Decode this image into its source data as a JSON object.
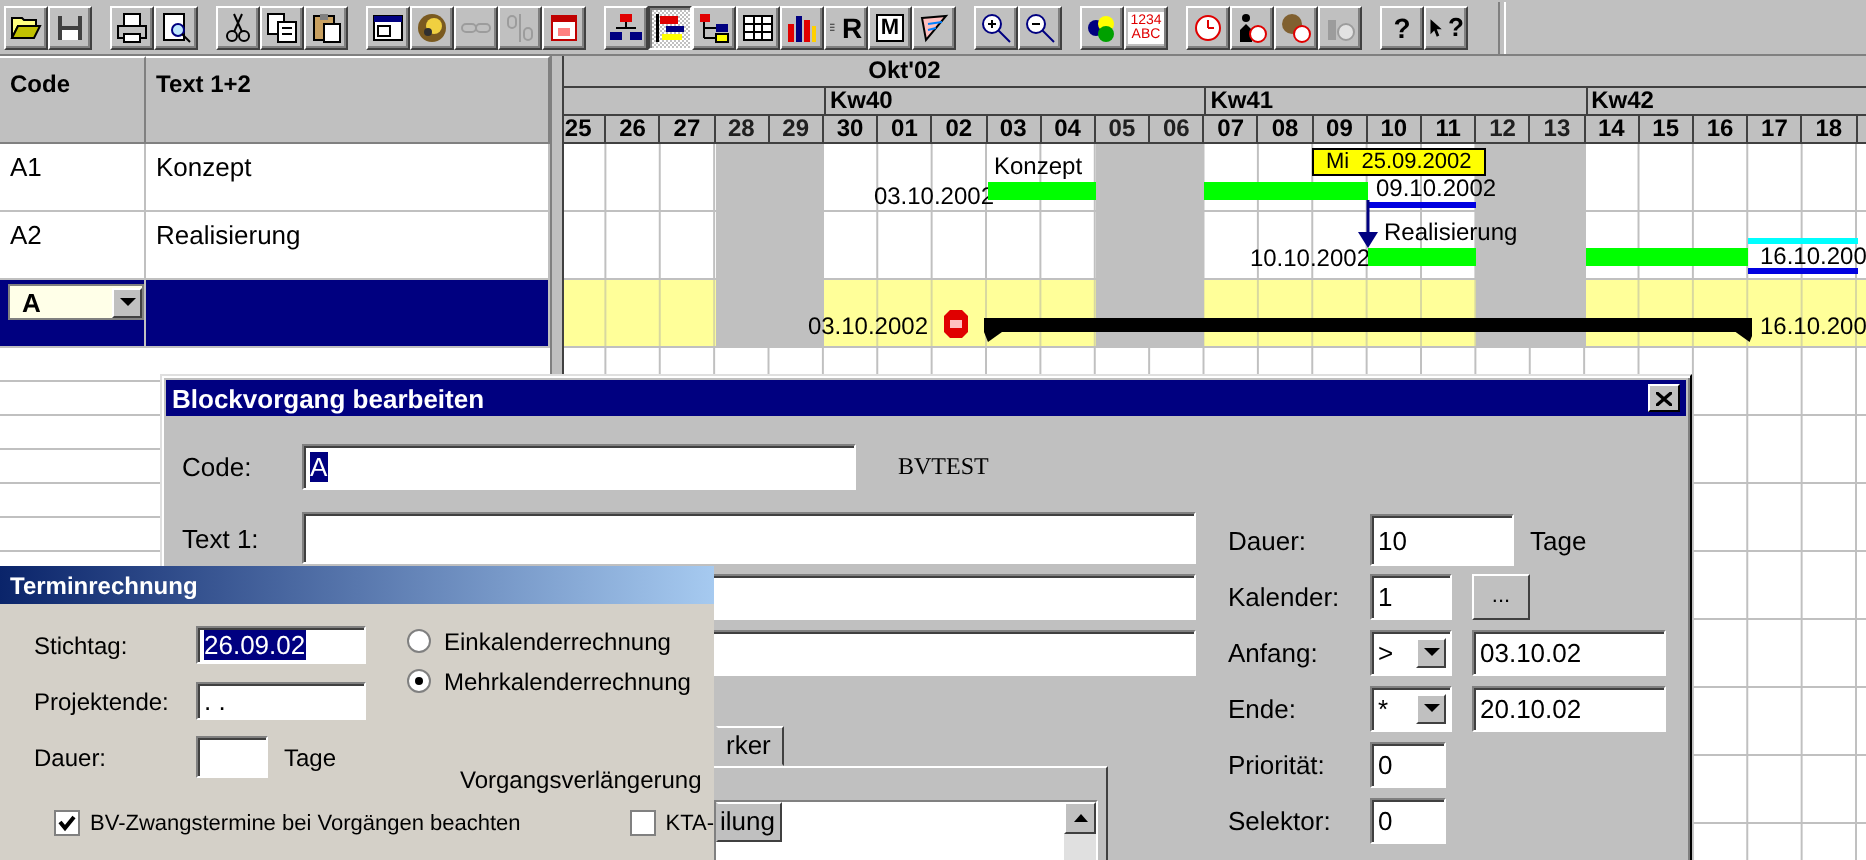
{
  "toolbar": [
    [
      {
        "kind": "folder",
        "pressed": false,
        "disabled": false
      },
      {
        "kind": "save",
        "pressed": false,
        "disabled": false
      }
    ],
    [
      {
        "kind": "printer",
        "pressed": false,
        "disabled": false
      },
      {
        "kind": "preview",
        "pressed": false,
        "disabled": false
      }
    ],
    [
      {
        "kind": "scissors",
        "pressed": false,
        "disabled": false
      },
      {
        "kind": "copy",
        "pressed": false,
        "disabled": false
      },
      {
        "kind": "paste",
        "pressed": false,
        "disabled": false
      }
    ],
    [
      {
        "kind": "window",
        "pressed": false,
        "disabled": false
      },
      {
        "kind": "globe",
        "pressed": false,
        "disabled": false
      },
      {
        "kind": "chain",
        "pressed": false,
        "disabled": true
      },
      {
        "kind": "unchain",
        "pressed": false,
        "disabled": true
      },
      {
        "kind": "calendar",
        "pressed": false,
        "disabled": false
      }
    ],
    [
      {
        "kind": "orgchart",
        "pressed": false,
        "disabled": false
      },
      {
        "kind": "gantt",
        "pressed": true,
        "disabled": false
      },
      {
        "kind": "tree",
        "pressed": false,
        "disabled": false
      },
      {
        "kind": "table",
        "pressed": false,
        "disabled": false
      },
      {
        "kind": "barchart",
        "pressed": false,
        "disabled": false
      },
      {
        "kind": "report",
        "label": "R",
        "pressed": false,
        "disabled": false
      },
      {
        "kind": "letter",
        "label": "M",
        "pressed": false,
        "disabled": false
      },
      {
        "kind": "pen",
        "pressed": false,
        "disabled": false
      }
    ],
    [
      {
        "kind": "zoomin",
        "pressed": false,
        "disabled": false
      },
      {
        "kind": "zoomout",
        "pressed": false,
        "disabled": false
      }
    ],
    [
      {
        "kind": "circles",
        "pressed": false,
        "disabled": false
      },
      {
        "kind": "numbers",
        "label_lines": [
          "1234",
          "ABC"
        ],
        "pressed": false,
        "disabled": false
      }
    ],
    [
      {
        "kind": "clock",
        "pressed": false,
        "disabled": false
      },
      {
        "kind": "clockperson",
        "pressed": false,
        "disabled": false
      },
      {
        "kind": "clockcolor",
        "pressed": false,
        "disabled": false
      },
      {
        "kind": "clockgrey",
        "pressed": false,
        "disabled": true
      }
    ],
    [
      {
        "kind": "help",
        "label": "?",
        "pressed": false,
        "disabled": false
      },
      {
        "kind": "pointer",
        "label": "?",
        "pressed": false,
        "disabled": false
      }
    ]
  ],
  "table": {
    "columns": [
      "Code",
      "Text 1+2"
    ],
    "rows": [
      {
        "code": "A1",
        "text": "Konzept",
        "selected": false
      },
      {
        "code": "A2",
        "text": "Realisierung",
        "selected": false
      },
      {
        "code": "A",
        "selected": true
      }
    ]
  },
  "gantt": {
    "days": [
      {
        "day": "25",
        "weekend": false
      },
      {
        "day": "26",
        "weekend": false
      },
      {
        "day": "27",
        "weekend": false
      },
      {
        "day": "28",
        "weekend": true
      },
      {
        "day": "29",
        "weekend": true
      },
      {
        "day": "30",
        "weekend": false,
        "week": "Kw40"
      },
      {
        "day": "01",
        "weekend": false,
        "month": "Okt'02"
      },
      {
        "day": "02",
        "weekend": false
      },
      {
        "day": "03",
        "weekend": false
      },
      {
        "day": "04",
        "weekend": false
      },
      {
        "day": "05",
        "weekend": true
      },
      {
        "day": "06",
        "weekend": true
      },
      {
        "day": "07",
        "weekend": false,
        "week": "Kw41"
      },
      {
        "day": "08",
        "weekend": false
      },
      {
        "day": "09",
        "weekend": false
      },
      {
        "day": "10",
        "weekend": false
      },
      {
        "day": "11",
        "weekend": false
      },
      {
        "day": "12",
        "weekend": true
      },
      {
        "day": "13",
        "weekend": true
      },
      {
        "day": "14",
        "weekend": false,
        "week": "Kw42"
      },
      {
        "day": "15",
        "weekend": false
      },
      {
        "day": "16",
        "weekend": false
      },
      {
        "day": "17",
        "weekend": false
      },
      {
        "day": "18",
        "weekend": false
      }
    ],
    "rows": [
      {
        "kind": "task",
        "name": "Konzept",
        "start_date": "03.10.2002",
        "end_date": "09.10.2002"
      },
      {
        "kind": "task",
        "name": "Realisierung",
        "start_date": "10.10.2002",
        "end_date": "16.10.200"
      },
      {
        "kind": "block",
        "start_date": "03.10.2002",
        "end_date": "16.10.200"
      }
    ],
    "tooltip": "Mi  25.09.2002"
  },
  "block_dialog": {
    "title": "Blockvorgang bearbeiten",
    "code": {
      "label": "Code:",
      "value": "A",
      "highlighted": true
    },
    "project": "BVTEST",
    "text1": {
      "label": "Text 1:"
    },
    "dauer": {
      "label": "Dauer:",
      "value": "10",
      "unit": "Tage"
    },
    "kalender": {
      "label": "Kalender:",
      "value": "1",
      "button": "..."
    },
    "anfang": {
      "label": "Anfang:",
      "mode": ">",
      "value": "03.10.02"
    },
    "ende": {
      "label": "Ende:",
      "mode": "*",
      "value": "20.10.02"
    },
    "prioritaet": {
      "label": "Priorität:",
      "value": "0"
    },
    "selektor": {
      "label": "Selektor:",
      "value": "0"
    },
    "tab": "rker",
    "list_header": "ilung"
  },
  "termin_dialog": {
    "title": "Terminrechnung",
    "stichtag": {
      "label": "Stichtag:",
      "value": "26.09.02",
      "highlighted": true
    },
    "projektende": {
      "label": "Projektende:",
      "value": ". ."
    },
    "dauer": {
      "label": "Dauer:",
      "unit": "Tage"
    },
    "radios": [
      {
        "label": "Einkalenderrechnung",
        "selected": false
      },
      {
        "label": "Mehrkalenderrechnung",
        "selected": true
      }
    ],
    "extension_label": "Vorgangsverlängerung",
    "checkboxes": [
      {
        "label": "BV-Zwangstermine bei Vorgängen beachten",
        "checked": true
      },
      {
        "label": "KTA-",
        "checked": false
      }
    ]
  }
}
